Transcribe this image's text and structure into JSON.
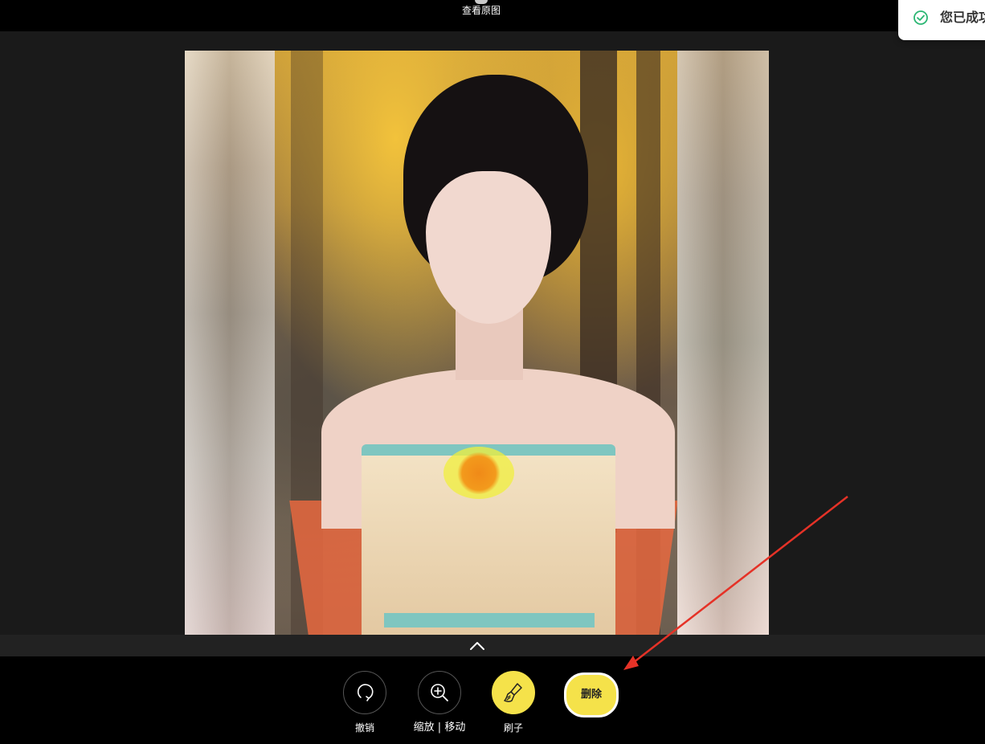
{
  "topbar": {
    "view_original_label": "查看原图"
  },
  "toast": {
    "message": "您已成功",
    "status_color": "#2bb673"
  },
  "image": {
    "description_icon": "photo-canvas"
  },
  "toolbar": {
    "undo_label": "撤销",
    "zoom_label": "缩放 | 移动",
    "brush_label": "刷子",
    "delete_label": "删除",
    "accent_color": "#f5e24a"
  },
  "icons": {
    "undo": "undo-icon",
    "zoom": "zoom-in-icon",
    "brush": "brush-icon",
    "panel_toggle": "chevron-up-icon"
  }
}
